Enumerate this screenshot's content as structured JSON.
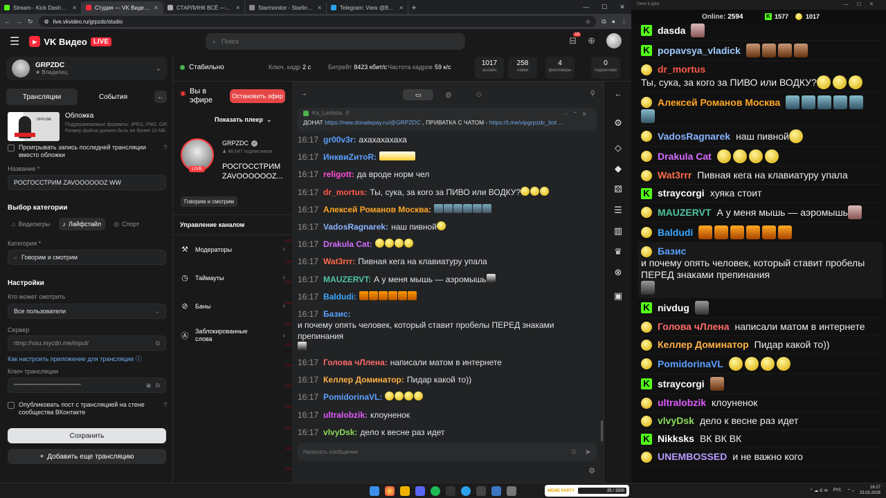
{
  "browser": {
    "tabs": [
      {
        "label": "Stream - Kick Dashboard",
        "color": "#53fc18",
        "active": false
      },
      {
        "label": "Студия — VK Видео Live",
        "color": "#ff2b3c",
        "active": true
      },
      {
        "label": "СТАРЛИНК ВСЁ — мы проигр",
        "color": "#aaaaaa",
        "active": false
      },
      {
        "label": "Starmonitor - Starlink Tracker",
        "color": "#888888",
        "active": false
      },
      {
        "label": "Telegram: View @BotovcdX",
        "color": "#2aa3ef",
        "active": false
      }
    ],
    "url": "live.vkvideo.ru/grpzdc/studio"
  },
  "header": {
    "logo_text": "VK Видео",
    "logo_badge": "LIVE",
    "search_placeholder": "Поиск",
    "notif_badge": "15"
  },
  "left": {
    "channel_name": "GRPZDC",
    "channel_role": "Владелец",
    "tab_streams": "Трансляции",
    "tab_events": "События",
    "cover_title": "Обложка",
    "cover_desc": "Поддерживаемые форматы: JPEG, PNG, GIF. Размер файла должен быть не более 10 МБ",
    "cover_thumb_text": "OFFLINE",
    "play_last_label": "Проигрывать запись последней трансляции вместо обложки",
    "name_label": "Название *",
    "name_value": "РОСГОССТРИМ ZAVOOOOOOZ WW",
    "category_section": "Выбор категории",
    "cat_games": "Видеоигры",
    "cat_life": "Лайфстайл",
    "cat_sport": "Спорт",
    "category_label": "Категория *",
    "category_value": "Говорим и смотрим",
    "settings_section": "Настройки",
    "who_label": "Кто может смотреть",
    "who_value": "Все пользователи",
    "server_label": "Сервер",
    "server_value": "rtmp://vsu.mycdn.me/input/",
    "howto_link": "Как настроить приложение для трансляции",
    "key_label": "Ключ трансляции",
    "key_value": "••••••••••••••••••••••••••••••••••••••••••••••",
    "publish_label": "Опубликовать пост с трансляцией на стене сообщества ВКонтакте",
    "save_button": "Сохранить",
    "add_button": "Добавить еще трансляцию"
  },
  "stats": {
    "status": "Стабильно",
    "keyframe_label": "Ключ. кадр",
    "keyframe_value": "2 с",
    "bitrate_label": "Битрейт",
    "bitrate_value": "8423 кбит/с",
    "fps_label": "Частота кадров",
    "fps_value": "59 к/с",
    "counters": [
      {
        "n": "1017",
        "l": "онлайн"
      },
      {
        "n": "258",
        "l": "лайки"
      },
      {
        "n": "4",
        "l": "фолловеры"
      },
      {
        "n": "0",
        "l": "подписчики"
      }
    ]
  },
  "mid": {
    "on_air": "Вы в эфире",
    "stop_button": "Остановить эфир",
    "show_player": "Показать плеер",
    "live_badge": "LIVE",
    "channel": "GRPZDC",
    "subscribers": "48,647 подписчиков",
    "stream_title": "РОСГОССТРИМ ZAVOOOOOOZ...",
    "tag": "Говорим и смотрим",
    "mgmt_title": "Управление каналом",
    "mgmt_items": [
      "Модераторы",
      "Таймауты",
      "Баны",
      "Заблокированные слова"
    ]
  },
  "chat": {
    "pinned_author": "Ka_Lambda",
    "pinned_prefix": "ДОНАТ",
    "pinned_link1": "https://new.donatepay.ru/@GRPZDC",
    "pinned_mid": ", ПРИВАТКА С ЧАТОМ -",
    "pinned_link2": "https://t.me/vipgrpzdc_bot ...",
    "input_placeholder": "Написать сообщение",
    "messages": [
      {
        "time": "16:17",
        "user": "gr00v3r:",
        "color": "#5aa0ff",
        "text": "ахахахахаха",
        "emotes": ""
      },
      {
        "time": "16:17",
        "user": "ИнквиZитоR:",
        "color": "#5aa0ff",
        "text": "",
        "emotes": "box"
      },
      {
        "time": "16:17",
        "user": "religott:",
        "color": "#ff4fd8",
        "text": "да вроде норм чел",
        "emotes": ""
      },
      {
        "time": "16:17",
        "user": "dr_mortus:",
        "color": "#ff5a4a",
        "text": "Ты, сука, за кого за ПИВО или ВОДКУ?",
        "emotes": "ppp"
      },
      {
        "time": "16:17",
        "user": "Алексей Романов Москва:",
        "color": "#ffa726",
        "text": "",
        "emotes": "ssssss"
      },
      {
        "time": "16:17",
        "user": "VadosRagnarek:",
        "color": "#8ab4ff",
        "text": "наш пивной",
        "emotes": "p"
      },
      {
        "time": "16:17",
        "user": "Drakula Cat:",
        "color": "#d56cff",
        "text": "",
        "emotes": "pppp"
      },
      {
        "time": "16:17",
        "user": "Wat3rrr:",
        "color": "#ff6b4a",
        "text": "Пивная кега на клавиатуру упала",
        "emotes": ""
      },
      {
        "time": "16:17",
        "user": "MAUZERVT:",
        "color": "#4fc3a1",
        "text": "А у меня мышь — аэромышь",
        "emotes": "b"
      },
      {
        "time": "16:17",
        "user": "Baldudi:",
        "color": "#3aa7ff",
        "text": "",
        "emotes": "tttttt"
      },
      {
        "time": "16:17",
        "user": "Базис:",
        "color": "#5aa0ff",
        "text": "и почему опять человек, который ставит пробелы ПЕРЕД знаками препинания",
        "emotes": "b"
      },
      {
        "time": "16:17",
        "user": "Голова чЛлена:",
        "color": "#ff6b6b",
        "text": "написали матом в интернете",
        "emotes": ""
      },
      {
        "time": "16:17",
        "user": "Келлер Доминатор:",
        "color": "#ffb347",
        "text": "Пидар какой то))",
        "emotes": ""
      },
      {
        "time": "16:17",
        "user": "PomidorinaVL:",
        "color": "#5aa0ff",
        "text": "",
        "emotes": "pppp"
      },
      {
        "time": "16:17",
        "user": "ultralobzik:",
        "color": "#e05cff",
        "text": "клоуненок",
        "emotes": ""
      },
      {
        "time": "16:17",
        "user": "vlvyDsk:",
        "color": "#8bdc5a",
        "text": "дело к весне раз идет",
        "emotes": ""
      },
      {
        "time": "16:17",
        "user": "UNEMBOSSED:",
        "color": "#b69cff",
        "text": "и не важно кого",
        "emotes": ""
      }
    ]
  },
  "overlay": {
    "title": "Окно в дуку",
    "online_label": "Online:",
    "online_value": "2594",
    "kick_count": "1577",
    "vk_count": "1017",
    "messages": [
      {
        "badge": "k",
        "user": "dasda",
        "color": "#ffffff",
        "text": "",
        "emotes": "f"
      },
      {
        "badge": "k",
        "user": "popavsya_vladick",
        "color": "#9ecbff",
        "text": "",
        "emotes": "mmmm"
      },
      {
        "badge": "p",
        "user": "dr_mortus",
        "color": "#ff5a4a",
        "text": "Ты, сука, за кого за ПИВО или ВОДКУ?",
        "emotes": "ppp"
      },
      {
        "badge": "p",
        "user": "Алексей Романов Москва",
        "color": "#ffa726",
        "text": "",
        "emotes": "ssssss"
      },
      {
        "badge": "p",
        "user": "VadosRagnarek",
        "color": "#8ab4ff",
        "text": "наш пивной",
        "emotes": "p"
      },
      {
        "badge": "p",
        "user": "Drakula Cat",
        "color": "#d56cff",
        "text": "",
        "emotes": "pppp"
      },
      {
        "badge": "p",
        "user": "Wat3rrr",
        "color": "#ff6b4a",
        "text": "Пивная кега на клавиатуру упала",
        "emotes": ""
      },
      {
        "badge": "k",
        "user": "straycorgi",
        "color": "#ffffff",
        "text": "хуяка стоит",
        "emotes": ""
      },
      {
        "badge": "p",
        "user": "MAUZERVT",
        "color": "#4fc3a1",
        "text": "А у меня мышь — аэромышь",
        "emotes": "f"
      },
      {
        "badge": "p",
        "user": "Baldudi",
        "color": "#3aa7ff",
        "text": "",
        "emotes": "tttttt"
      },
      {
        "badge": "p",
        "user": "Базис",
        "color": "#5aa0ff",
        "text": "и почему опять человек, который ставит пробелы ПЕРЕД знаками препинания",
        "emotes": "g"
      },
      {
        "badge": "k",
        "user": "nivdug",
        "color": "#ffffff",
        "text": "",
        "emotes": "g"
      },
      {
        "badge": "p",
        "user": "Голова чЛлена",
        "color": "#ff6b6b",
        "text": "написали матом в интернете",
        "emotes": ""
      },
      {
        "badge": "p",
        "user": "Келлер Доминатор",
        "color": "#ffb347",
        "text": "Пидар какой то))",
        "emotes": ""
      },
      {
        "badge": "p",
        "user": "PomidorinaVL",
        "color": "#5aa0ff",
        "text": "",
        "emotes": "pppp"
      },
      {
        "badge": "k",
        "user": "straycorgi",
        "color": "#ffffff",
        "text": "",
        "emotes": "k"
      },
      {
        "badge": "p",
        "user": "ultralobzik",
        "color": "#e05cff",
        "text": "клоуненок",
        "emotes": ""
      },
      {
        "badge": "p",
        "user": "vlvyDsk",
        "color": "#8bdc5a",
        "text": "дело к весне раз идет",
        "emotes": ""
      },
      {
        "badge": "k",
        "user": "Nikksks",
        "color": "#ffffff",
        "text": "ВК ВК ВК",
        "emotes": ""
      },
      {
        "badge": "p",
        "user": "UNEMBOSSED",
        "color": "#b69cff",
        "text": "и не важно кого",
        "emotes": ""
      }
    ]
  },
  "taskbar": {
    "widget_name": "MEME PARTY",
    "widget_progress": "25 / 1500",
    "lang": "РУС",
    "time": "16:17",
    "date": "23.02.2026"
  }
}
